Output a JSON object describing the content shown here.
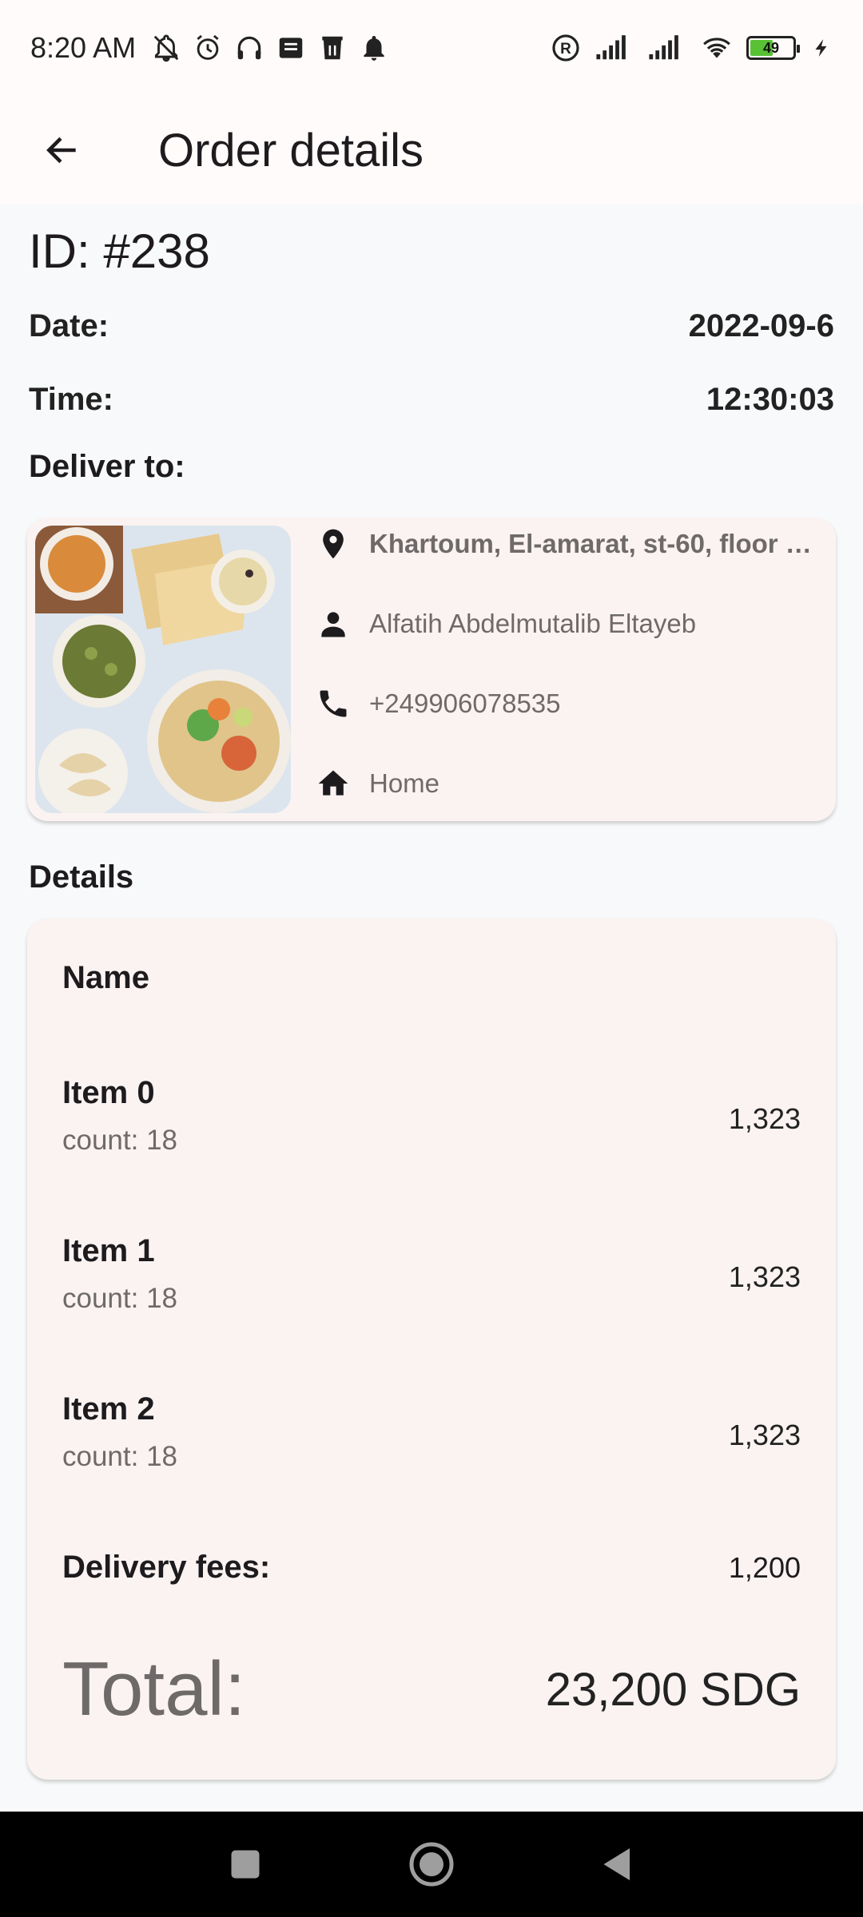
{
  "status": {
    "time": "8:20 AM",
    "battery": "49",
    "icons_left": [
      "bell-off-icon",
      "alarm-icon",
      "headphones-icon",
      "message-icon",
      "trash-icon",
      "bell-icon"
    ],
    "icons_right": [
      "registered-icon",
      "signal-icon",
      "signal-icon",
      "wifi-icon",
      "battery-icon",
      "charging-icon"
    ]
  },
  "app_bar": {
    "title": "Order details"
  },
  "order": {
    "id": "ID: #238",
    "date_label": "Date:",
    "date": "2022-09-6",
    "time_label": "Time:",
    "time": "12:30:03",
    "deliver_label": "Deliver to:"
  },
  "delivery": {
    "address": "Khartoum, El-amarat, st-60, floor …",
    "name": "Alfatih Abdelmutalib Eltayeb",
    "phone": "+249906078535",
    "place": "Home"
  },
  "details": {
    "label": "Details",
    "name_head": "Name",
    "items": [
      {
        "name": "Item 0",
        "count": "count: 18",
        "price": "1,323"
      },
      {
        "name": "Item 1",
        "count": "count: 18",
        "price": "1,323"
      },
      {
        "name": "Item 2",
        "count": "count: 18",
        "price": "1,323"
      }
    ],
    "fees_label": "Delivery fees:",
    "fees": "1,200",
    "total_label": "Total:",
    "total": "23,200 SDG"
  },
  "colors": {
    "card_bg": "#fbf3f2",
    "page_bg": "#f8f9fa",
    "muted_text": "#6f6a6a",
    "battery_fill": "#58c234"
  }
}
